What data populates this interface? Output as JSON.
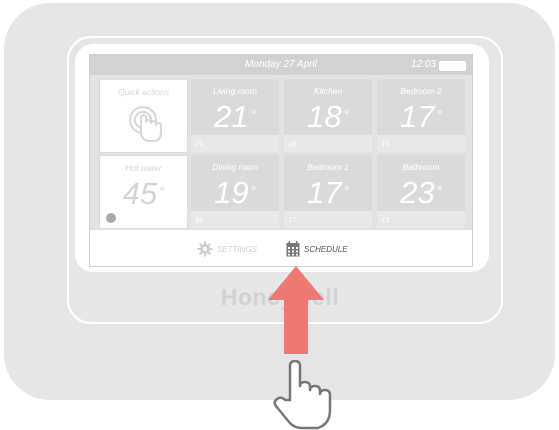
{
  "header": {
    "date": "Monday 27 April",
    "time": "12:03"
  },
  "quick_actions": {
    "label": "Quick actions",
    "icon": "touch-hand-icon"
  },
  "zones": [
    {
      "name": "Living room",
      "temp": "21",
      "setpoint": "21"
    },
    {
      "name": "Kitchen",
      "temp": "18",
      "setpoint": "18"
    },
    {
      "name": "Bedroom 2",
      "temp": "17",
      "setpoint": "15"
    },
    {
      "name": "Dining room",
      "temp": "19",
      "setpoint": "18"
    },
    {
      "name": "Bedroom 1",
      "temp": "17",
      "setpoint": "17"
    },
    {
      "name": "Bathroom",
      "temp": "23",
      "setpoint": "23"
    }
  ],
  "hot_water": {
    "label": "Hot water",
    "temp": "45"
  },
  "footer": {
    "settings_label": "SETTINGS",
    "schedule_label": "SCHEDULE"
  },
  "brand": "Honeywell",
  "colors": {
    "arrow": "#f07872",
    "screen_tile": "#dadada",
    "casing": "#e6e6e6"
  }
}
